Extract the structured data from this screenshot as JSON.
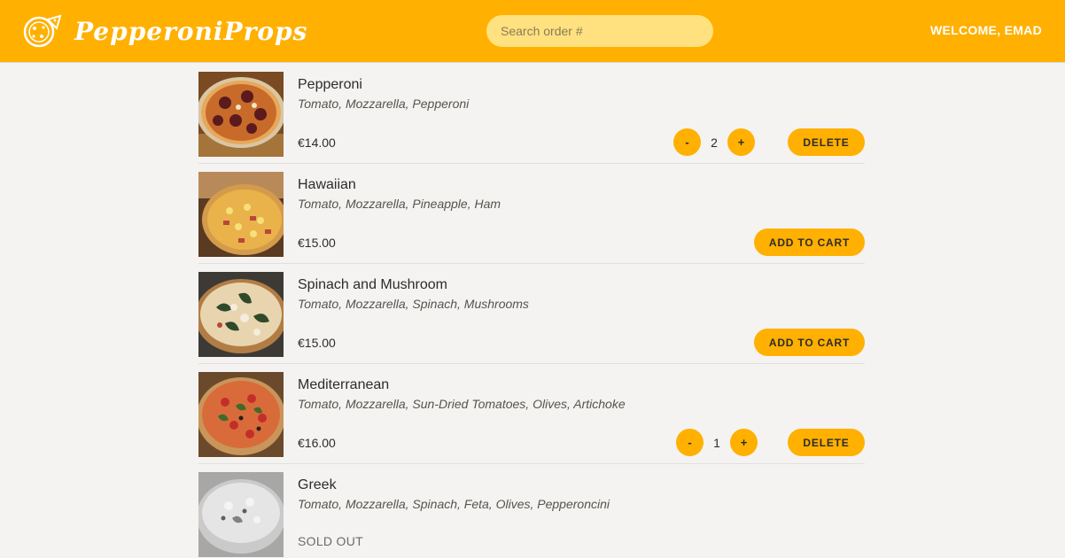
{
  "header": {
    "brand": "PepperoniProps",
    "search_placeholder": "Search order #",
    "welcome": "WELCOME, EMAD"
  },
  "colors": {
    "accent": "#ffb000",
    "search_bg": "#ffe27f",
    "page_bg": "#f4f3f1"
  },
  "menu": [
    {
      "name": "Pepperoni",
      "ingredients": "Tomato, Mozzarella, Pepperoni",
      "price": "€14.00",
      "in_cart": true,
      "quantity": "2",
      "minus": "-",
      "plus": "+",
      "action": "DELETE",
      "sold_out": false
    },
    {
      "name": "Hawaiian",
      "ingredients": "Tomato, Mozzarella, Pineapple, Ham",
      "price": "€15.00",
      "in_cart": false,
      "action": "ADD TO CART",
      "sold_out": false
    },
    {
      "name": "Spinach and Mushroom",
      "ingredients": "Tomato, Mozzarella, Spinach, Mushrooms",
      "price": "€15.00",
      "in_cart": false,
      "action": "ADD TO CART",
      "sold_out": false
    },
    {
      "name": "Mediterranean",
      "ingredients": "Tomato, Mozzarella, Sun-Dried Tomatoes, Olives, Artichoke",
      "price": "€16.00",
      "in_cart": true,
      "quantity": "1",
      "minus": "-",
      "plus": "+",
      "action": "DELETE",
      "sold_out": false
    },
    {
      "name": "Greek",
      "ingredients": "Tomato, Mozzarella, Spinach, Feta, Olives, Pepperoncini",
      "status": "SOLD OUT",
      "sold_out": true
    }
  ]
}
